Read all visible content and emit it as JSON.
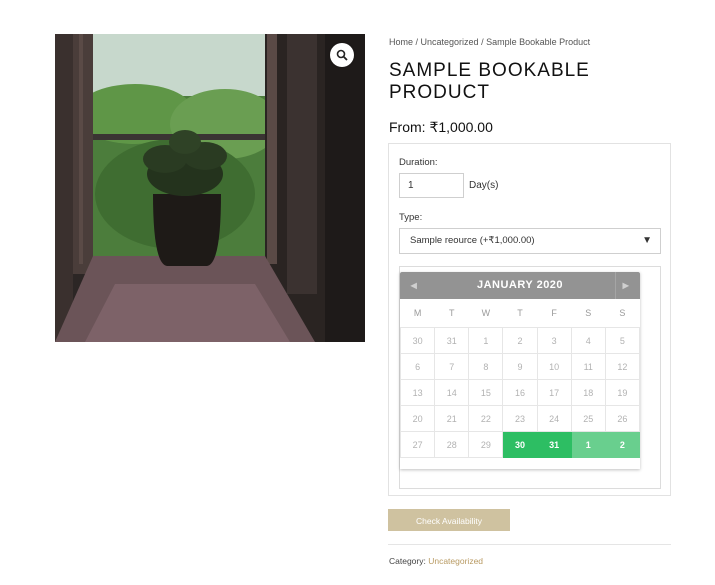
{
  "breadcrumb": {
    "home": "Home",
    "sep1": " / ",
    "category": "Uncategorized",
    "sep2": " / ",
    "current": "Sample Bookable Product"
  },
  "product": {
    "title": "SAMPLE BOOKABLE PRODUCT",
    "price_prefix": "From: ",
    "price": "₹1,000.00"
  },
  "form": {
    "duration_label": "Duration:",
    "duration_value": "1",
    "duration_unit": "Day(s)",
    "type_label": "Type:",
    "type_selected": "Sample reource (+₹1,000.00)"
  },
  "calendar": {
    "month_title": "JANUARY 2020",
    "weekdays": [
      "M",
      "T",
      "W",
      "T",
      "F",
      "S",
      "S"
    ],
    "weeks": [
      [
        "30",
        "31",
        "1",
        "2",
        "3",
        "4",
        "5"
      ],
      [
        "6",
        "7",
        "8",
        "9",
        "10",
        "11",
        "12"
      ],
      [
        "13",
        "14",
        "15",
        "16",
        "17",
        "18",
        "19"
      ],
      [
        "20",
        "21",
        "22",
        "23",
        "24",
        "25",
        "26"
      ],
      [
        "27",
        "28",
        "29",
        "30",
        "31",
        "1",
        "2"
      ]
    ],
    "available_dark": [
      "30",
      "31"
    ],
    "available_light": [
      "1",
      "2"
    ]
  },
  "actions": {
    "check_label": "Check Availability"
  },
  "meta": {
    "category_label": "Category: ",
    "category_value": "Uncategorized"
  },
  "icons": {
    "zoom": "magnifier-icon",
    "prev": "chevron-left-icon",
    "next": "chevron-right-icon",
    "select_arrow": "caret-down-icon"
  },
  "colors": {
    "button": "#cfc2a0",
    "available": "#2dbe63",
    "available_light": "#69cf8e",
    "calendar_header": "#939393",
    "category_link": "#b89a62"
  }
}
